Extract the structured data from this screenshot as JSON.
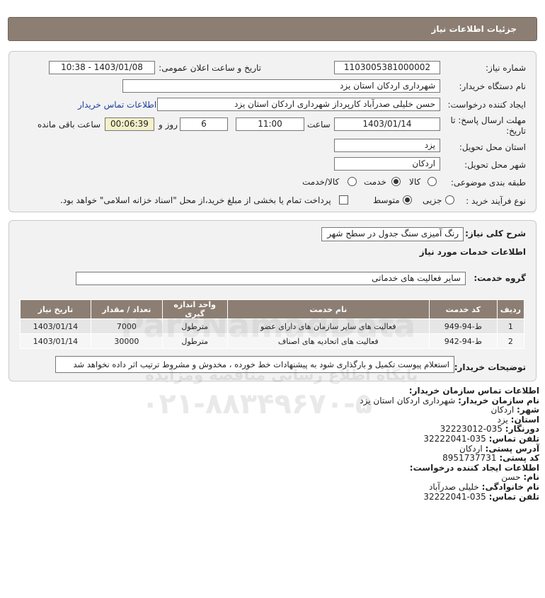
{
  "page_title": "جزئیات اطلاعات نیاز",
  "form": {
    "need_number": {
      "label": "شماره نیاز:",
      "value": "1103005381000002"
    },
    "announce_datetime": {
      "label": "تاریخ و ساعت اعلان عمومی:",
      "value": "1403/01/08 - 10:38"
    },
    "buyer_org": {
      "label": "نام دستگاه خریدار:",
      "value": "شهرداری اردکان استان یزد"
    },
    "requester": {
      "label": "ایجاد کننده درخواست:",
      "value": "حسن خلیلی صدرآباد کارپرداز شهرداری اردکان استان یزد",
      "contact_link": "اطلاعات تماس خریدار"
    },
    "deadline": {
      "label_line1": "مهلت ارسال پاسخ: تا",
      "label_line2": "تاریخ:",
      "date": "1403/01/14",
      "time_label": "ساعت",
      "time": "11:00",
      "days": "6",
      "days_label": "روز و",
      "remaining": "00:06:39",
      "remaining_label": "ساعت باقی مانده"
    },
    "delivery_province": {
      "label": "استان محل تحویل:",
      "value": "یزد"
    },
    "delivery_city": {
      "label": "شهر محل تحویل:",
      "value": "اردکان"
    },
    "category": {
      "label": "طبقه بندی موضوعی:",
      "options": [
        "کالا",
        "خدمت",
        "کالا/خدمت"
      ],
      "selected": "خدمت"
    },
    "purchase_process": {
      "label": "نوع فرآیند خرید :",
      "options": [
        "جزیی",
        "متوسط"
      ],
      "selected": "متوسط",
      "checkbox_text": "پرداخت تمام یا بخشی از مبلغ خرید،از محل \"اسناد خزانه اسلامی\" خواهد بود."
    }
  },
  "general": {
    "summary_label": "شرح کلی نیاز:",
    "summary_value": "رنگ آمیزی سنگ جدول در سطح شهر",
    "services_title": "اطلاعات خدمات مورد نیاز",
    "group_label": "گروه خدمت:",
    "group_value": "سایر فعالیت های خدماتی",
    "table": {
      "headers": [
        "ردیف",
        "کد خدمت",
        "نام خدمت",
        "واحد اندازه گیری",
        "تعداد / مقدار",
        "تاریخ نیاز"
      ],
      "rows": [
        [
          "1",
          "ط-94-949",
          "فعالیت های سایر سازمان های دارای عضو",
          "مترطول",
          "7000",
          "1403/01/14"
        ],
        [
          "2",
          "ط-94-942",
          "فعالیت های اتحادیه های اصناف",
          "مترطول",
          "30000",
          "1403/01/14"
        ]
      ]
    },
    "buyer_notes_label": "توضیحات خریدار:",
    "buyer_notes_value": "استعلام پیوست تکمیل و بارگذاری شود به پیشنهادات خط خورده ، مخدوش و مشروط ترتیب اثر داده نخواهد شد"
  },
  "contact_info": {
    "org_title": "اطلاعات تماس سازمان خریدار:",
    "org_name_label": "نام سازمان خریدار:",
    "org_name": "شهرداری اردکان استان یزد",
    "city_label": "شهر:",
    "city": "اردکان",
    "province_label": "استان:",
    "province": "یزد",
    "fax_label": "دورنگار:",
    "fax": "035-32223012",
    "phone_label": "تلفن تماس:",
    "phone": "035-32222041",
    "address_label": "آدرس پستی:",
    "address": "اردکان",
    "postal_label": "کد پستی:",
    "postal": "8951737731",
    "creator_title": "اطلاعات ایجاد کننده درخواست:",
    "first_name_label": "نام:",
    "first_name": "حسن",
    "last_name_label": "نام خانوادگی:",
    "last_name": "خلیلی صدرآباد",
    "creator_phone_label": "تلفن تماس:",
    "creator_phone": "035-32222041"
  },
  "watermark": {
    "line1": "ParsNamadData",
    "line2": "پایگاه اطلاع رسانی مناقصه ومزایده",
    "line3": "۰۲۱-۸۸۳۴۹۶۷۰-۵"
  },
  "colors": {
    "header_bg": "#8c7e72",
    "link": "#1e3e9e",
    "remaining_bg": "#f4f0c9"
  }
}
